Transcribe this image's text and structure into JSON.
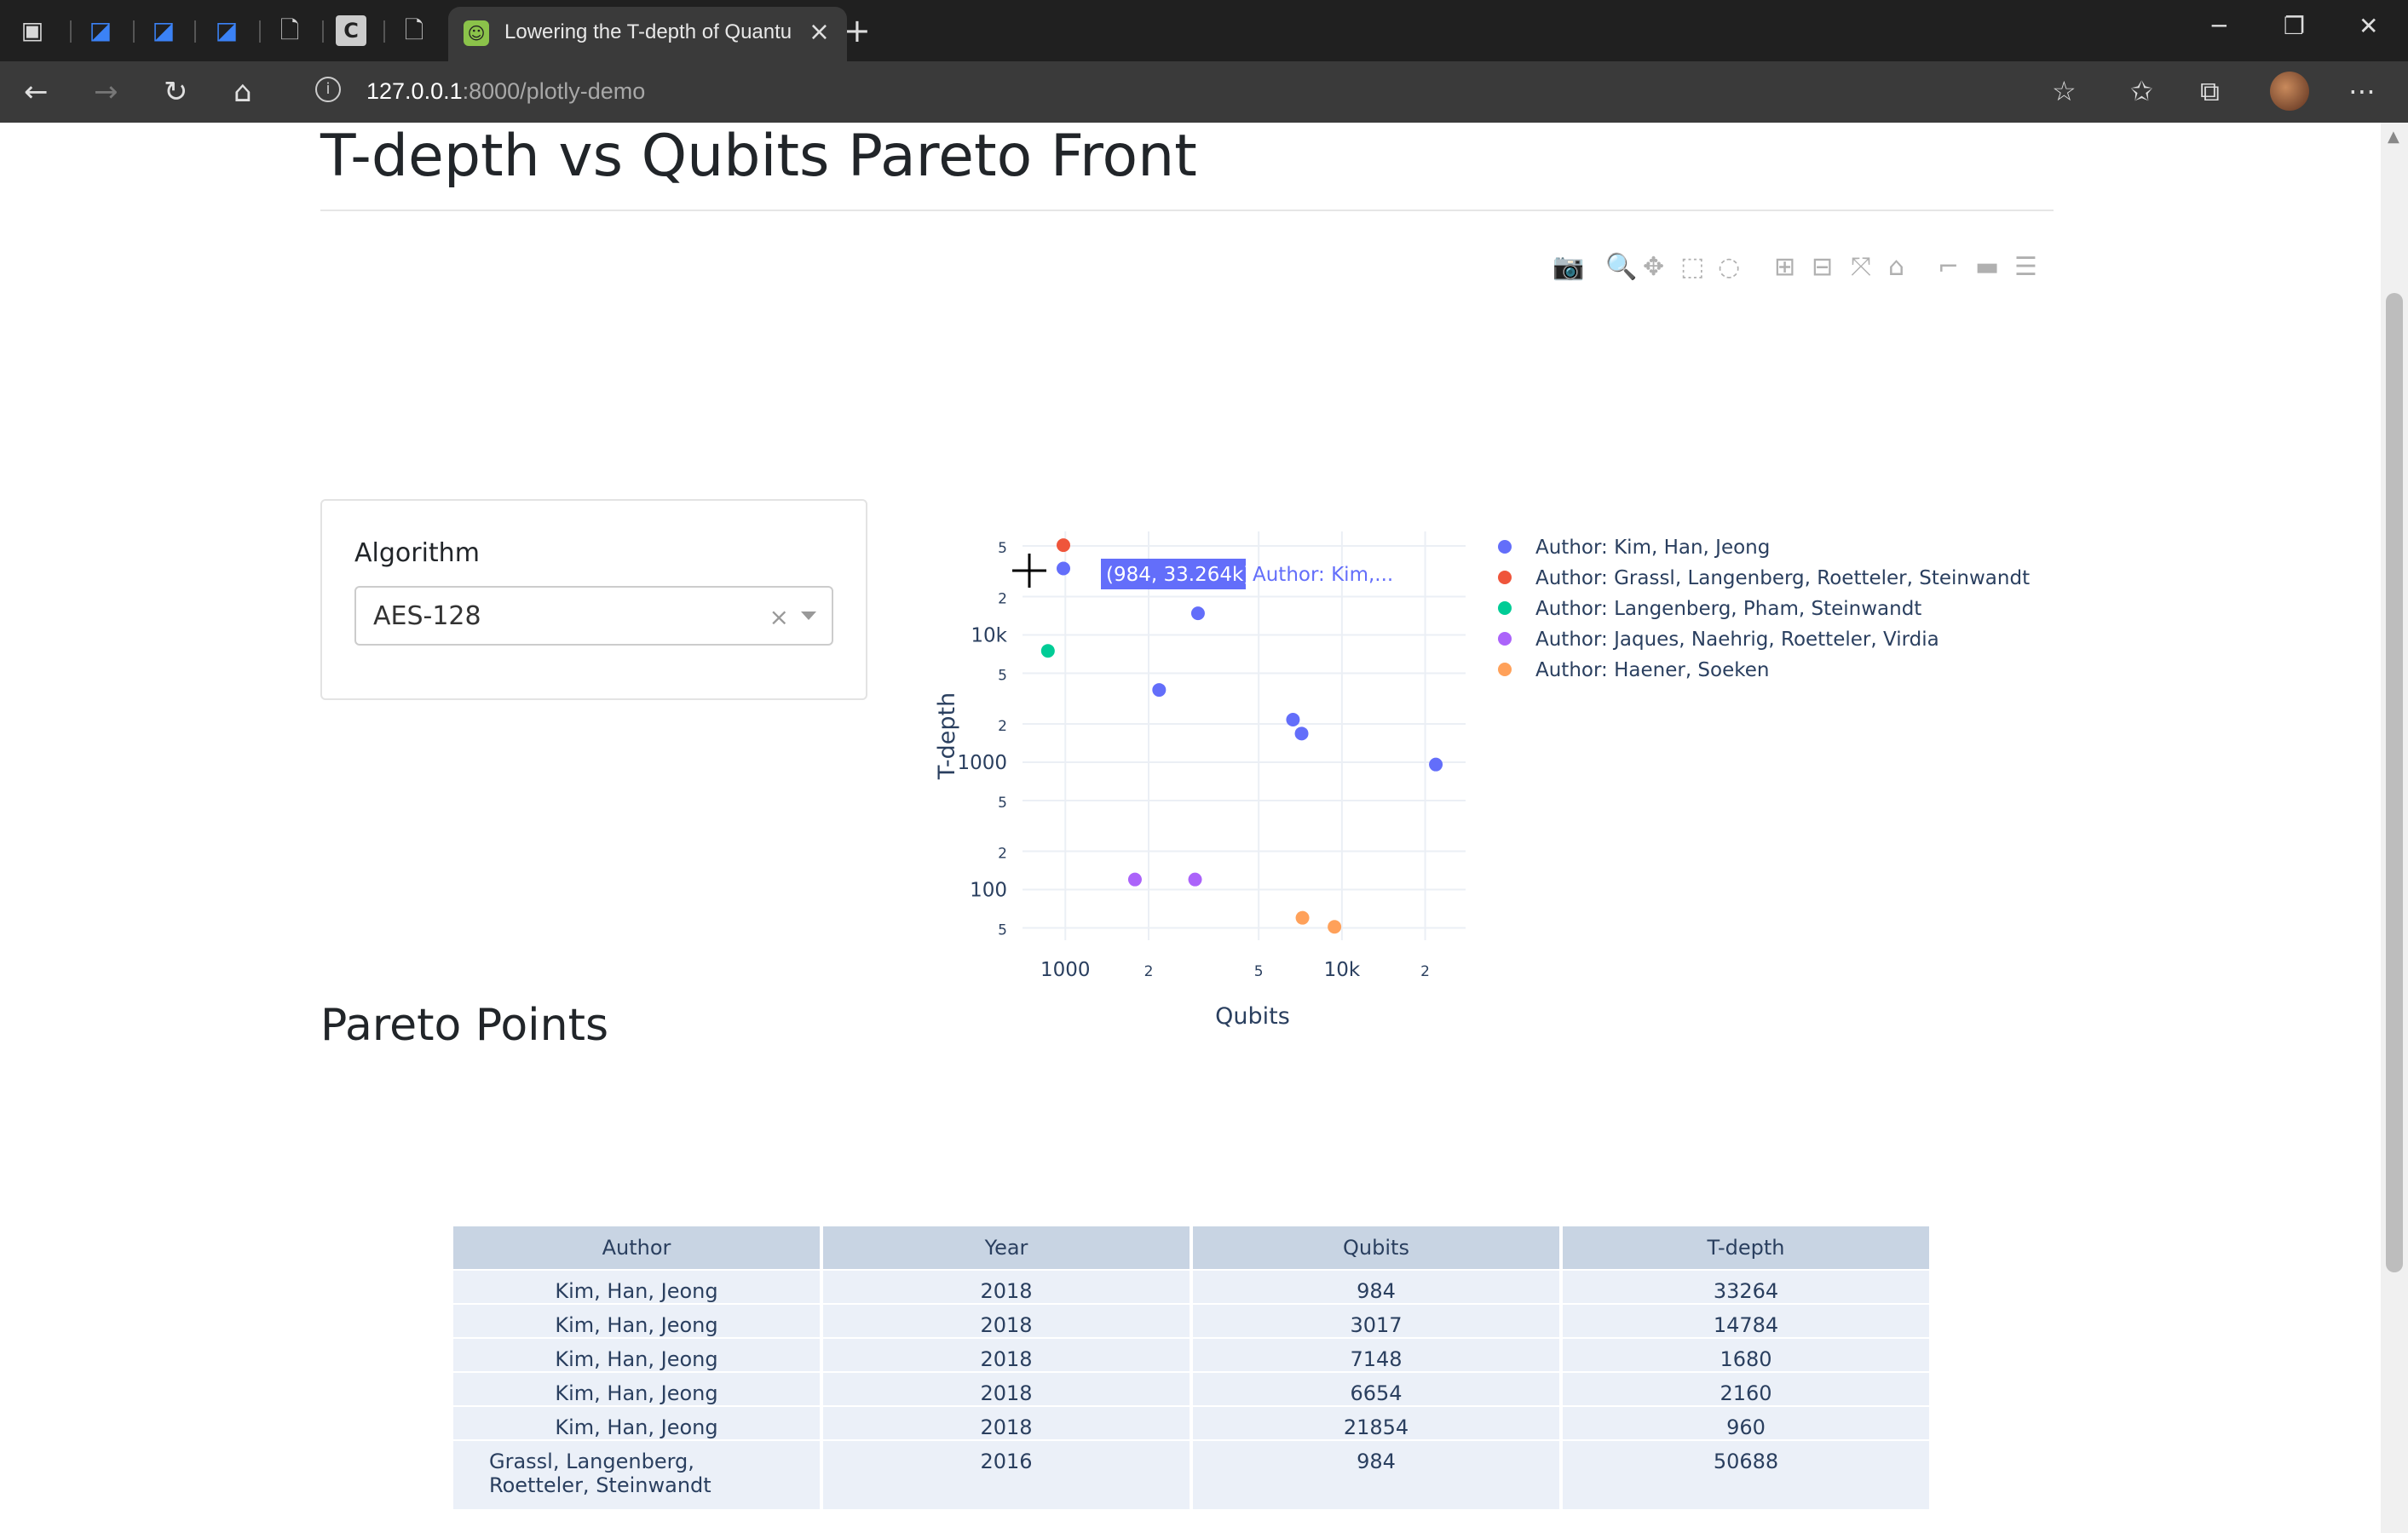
{
  "browser": {
    "active_tab_title": "Lowering the T-depth of Quantu",
    "url_host": "127.0.0.1",
    "url_path": ":8000/plotly-demo"
  },
  "page": {
    "title": "T-depth vs Qubits Pareto Front",
    "filter": {
      "label": "Algorithm",
      "value": "AES-128"
    },
    "table_heading": "Pareto Points"
  },
  "hover": {
    "coords": "(984, 33.264k)",
    "label": "Author: Kim,..."
  },
  "chart_data": {
    "type": "scatter",
    "xlabel": "Qubits",
    "ylabel": "T-depth",
    "x_scale": "log",
    "y_scale": "log",
    "x_ticks": [
      "1000",
      "2",
      "5",
      "10k",
      "2"
    ],
    "y_ticks": [
      "5",
      "2",
      "10k",
      "5",
      "2",
      "1000",
      "5",
      "2",
      "100",
      "5"
    ],
    "legend_position": "right",
    "series": [
      {
        "name": "Author: Kim, Han, Jeong",
        "color": "#636efa",
        "x": [
          984,
          3017,
          7148,
          6654,
          21854,
          2183
        ],
        "y": [
          33264,
          14784,
          1680,
          2160,
          960,
          3700
        ]
      },
      {
        "name": "Author: Grassl, Langenberg, Roetteler, Steinwandt",
        "color": "#ef553b",
        "x": [
          984
        ],
        "y": [
          50688
        ]
      },
      {
        "name": "Author: Langenberg, Pham, Steinwandt",
        "color": "#00cc96",
        "x": [
          865
        ],
        "y": [
          7500
        ]
      },
      {
        "name": "Author: Jaques, Naehrig, Roetteler, Virdia",
        "color": "#ab63fa",
        "x": [
          1785,
          2945
        ],
        "y": [
          120,
          120
        ]
      },
      {
        "name": "Author: Haener, Soeken",
        "color": "#ffa15a",
        "x": [
          7200,
          9400
        ],
        "y": [
          60,
          51
        ]
      }
    ]
  },
  "table": {
    "columns": [
      "Author",
      "Year",
      "Qubits",
      "T-depth"
    ],
    "rows": [
      [
        "Kim, Han, Jeong",
        "2018",
        "984",
        "33264"
      ],
      [
        "Kim, Han, Jeong",
        "2018",
        "3017",
        "14784"
      ],
      [
        "Kim, Han, Jeong",
        "2018",
        "7148",
        "1680"
      ],
      [
        "Kim, Han, Jeong",
        "2018",
        "6654",
        "2160"
      ],
      [
        "Kim, Han, Jeong",
        "2018",
        "21854",
        "960"
      ],
      [
        "Grassl, Langenberg, Roetteler, Steinwandt",
        "2016",
        "984",
        "50688"
      ]
    ]
  }
}
